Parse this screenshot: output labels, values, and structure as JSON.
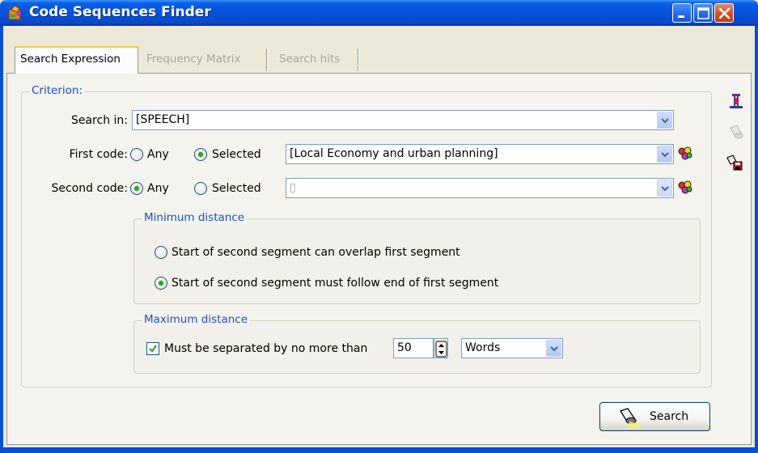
{
  "window": {
    "title": "Code Sequences Finder"
  },
  "tabs": [
    {
      "label": "Search Expression",
      "active": true
    },
    {
      "label": "Frequency Matrix",
      "active": false
    },
    {
      "label": "Search hits",
      "active": false
    }
  ],
  "criterion": {
    "group_label": "Criterion:",
    "search_in": {
      "label": "Search in:",
      "value": "[SPEECH]"
    },
    "first_code": {
      "label": "First code:",
      "any_label": "Any",
      "selected_label": "Selected",
      "selection": "Selected",
      "value": "[Local Economy and urban planning]"
    },
    "second_code": {
      "label": "Second code:",
      "any_label": "Any",
      "selected_label": "Selected",
      "selection": "Any",
      "value": "▯"
    },
    "minimum_distance": {
      "group_label": "Minimum distance",
      "option_overlap": "Start of second segment can overlap first segment",
      "option_follow": "Start of second segment must follow end of first segment",
      "selected": "option_follow"
    },
    "maximum_distance": {
      "group_label": "Maximum distance",
      "checkbox_label": "Must be separated by no more than",
      "checked": true,
      "value": "50",
      "unit": "Words"
    }
  },
  "actions": {
    "search_label": "Search"
  },
  "colors": {
    "titlebar": "#0552db",
    "group_label": "#1c4fc4",
    "radio_dot": "#2fa42f",
    "check": "#2fa42f",
    "close_button": "#d54b22"
  },
  "icons": [
    "app-icon",
    "minimize-icon",
    "maximize-icon",
    "close-icon",
    "coded-segment-icon",
    "flashlight-icon",
    "flashlight-save-icon",
    "color-codes-icon",
    "chevron-down-icon",
    "spinner-icon"
  ]
}
